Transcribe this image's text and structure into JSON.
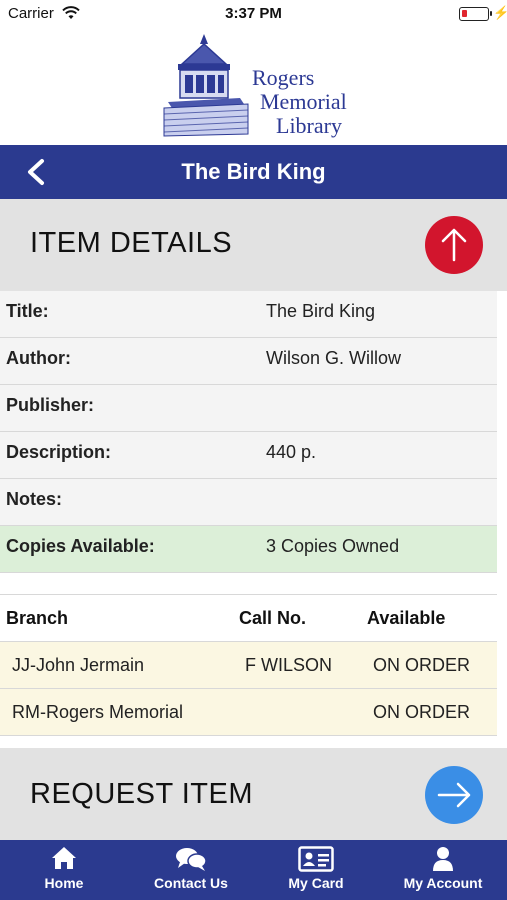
{
  "status_bar": {
    "carrier": "Carrier",
    "time": "3:37 PM",
    "battery_color": "#e0262f"
  },
  "logo": {
    "line1": "Rogers",
    "line2": "Memorial",
    "line3": "Library",
    "color": "#2c3994"
  },
  "nav": {
    "title": "The Bird King",
    "back_icon": "chevron-left-icon",
    "color": "#2b3a8f"
  },
  "item_details": {
    "heading": "ITEM DETAILS",
    "collapse_icon": "arrow-up-icon",
    "button_color": "#d2152d",
    "rows": [
      {
        "key": "Title:",
        "value": "The Bird King"
      },
      {
        "key": "Author:",
        "value": "Wilson G. Willow"
      },
      {
        "key": "Publisher:",
        "value": ""
      },
      {
        "key": "Description:",
        "value": "440 p."
      },
      {
        "key": "Notes:",
        "value": ""
      },
      {
        "key": "Copies Available:",
        "value": "3 Copies Owned"
      }
    ]
  },
  "holdings": {
    "headers": [
      "Branch",
      "Call No.",
      "Available"
    ],
    "rows": [
      {
        "branch": "JJ-John Jermain",
        "call_no": "F WILSON",
        "available": "ON ORDER"
      },
      {
        "branch": "RM-Rogers Memorial",
        "call_no": "",
        "available": "ON ORDER"
      }
    ]
  },
  "request": {
    "heading": "REQUEST ITEM",
    "icon": "arrow-right-icon",
    "button_color": "#3a8ee6"
  },
  "tabs": [
    {
      "label": "Home",
      "icon": "home-icon"
    },
    {
      "label": "Contact Us",
      "icon": "chat-icon"
    },
    {
      "label": "My Card",
      "icon": "id-card-icon"
    },
    {
      "label": "My Account",
      "icon": "user-icon"
    }
  ]
}
